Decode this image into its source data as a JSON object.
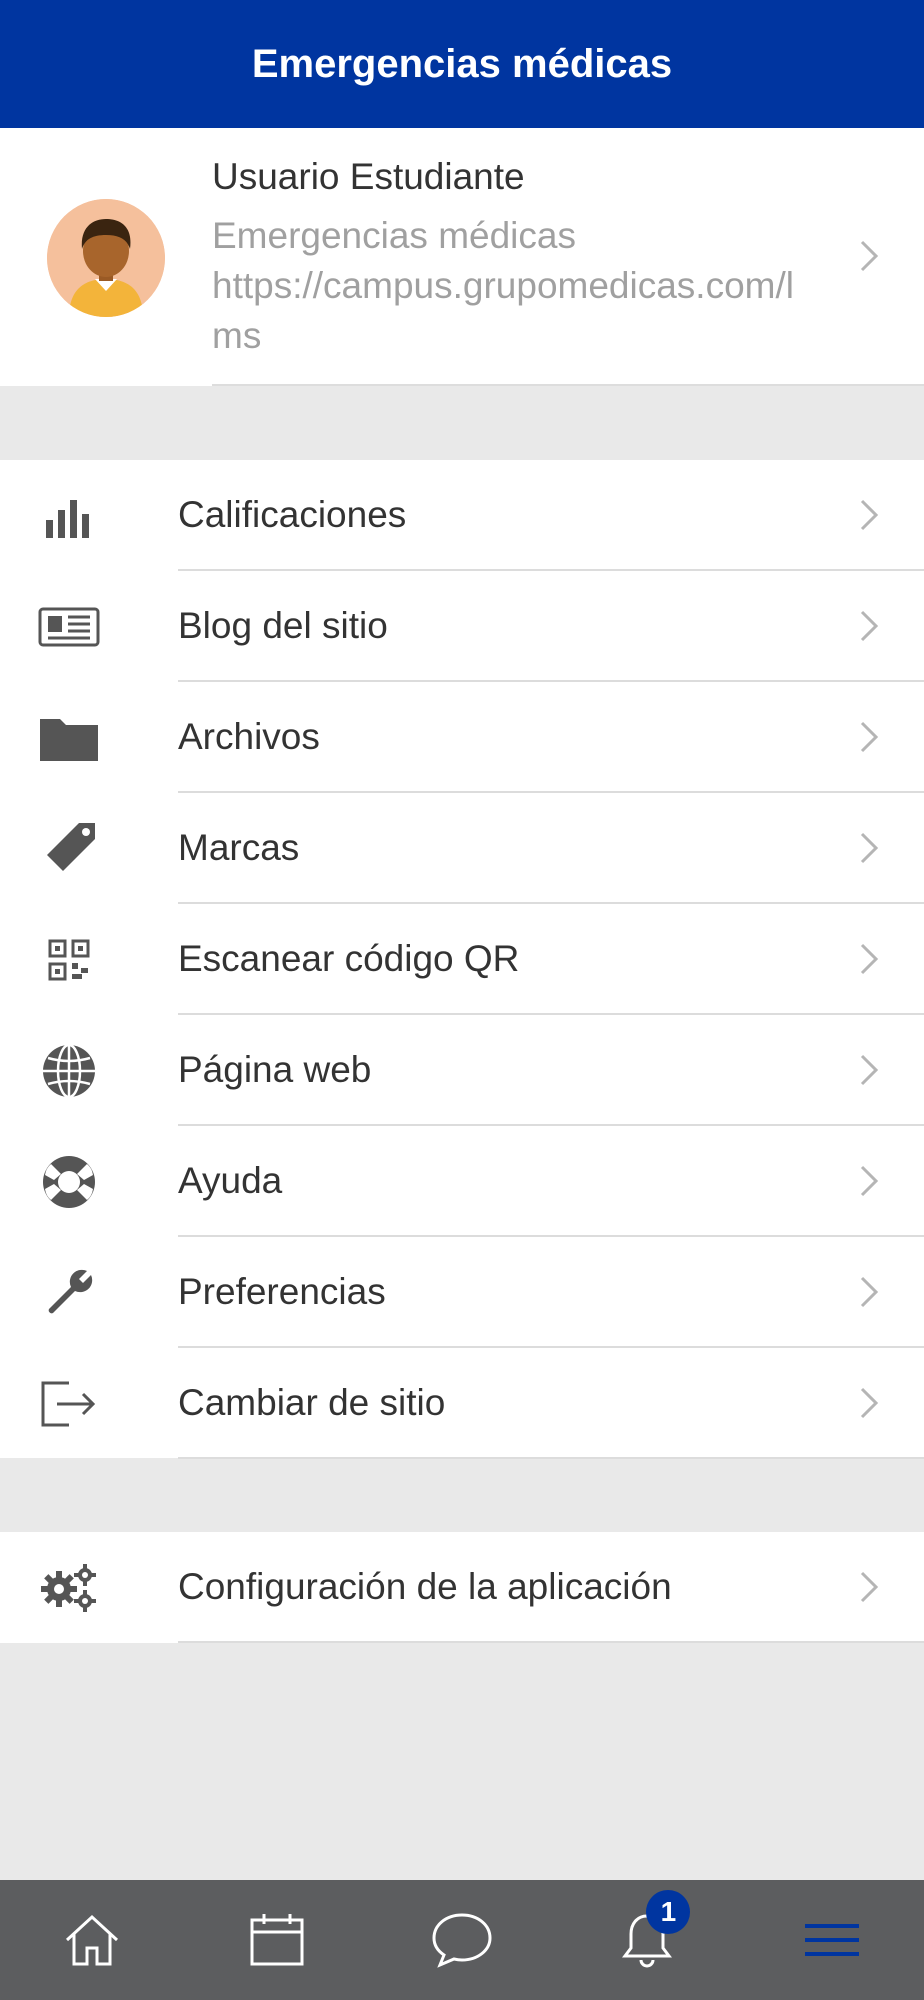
{
  "header": {
    "title": "Emergencias médicas"
  },
  "profile": {
    "name": "Usuario Estudiante",
    "site": "Emergencias médicas",
    "url": "https://campus.grupomedicas.com/lms"
  },
  "menu": {
    "items": [
      {
        "label": "Calificaciones",
        "icon": "bar-chart-icon"
      },
      {
        "label": "Blog del sitio",
        "icon": "newspaper-icon"
      },
      {
        "label": "Archivos",
        "icon": "folder-icon"
      },
      {
        "label": "Marcas",
        "icon": "tag-icon"
      },
      {
        "label": "Escanear código QR",
        "icon": "qr-code-icon"
      },
      {
        "label": "Página web",
        "icon": "globe-icon"
      },
      {
        "label": "Ayuda",
        "icon": "life-ring-icon"
      },
      {
        "label": "Preferencias",
        "icon": "wrench-icon"
      },
      {
        "label": "Cambiar de sitio",
        "icon": "sign-out-icon"
      }
    ]
  },
  "settings": {
    "label": "Configuración de la aplicación",
    "icon": "gears-icon"
  },
  "tabbar": {
    "tabs": [
      {
        "name": "home",
        "icon": "home-icon"
      },
      {
        "name": "calendar",
        "icon": "calendar-icon"
      },
      {
        "name": "messages",
        "icon": "chat-icon"
      },
      {
        "name": "notifications",
        "icon": "bell-icon"
      },
      {
        "name": "more",
        "icon": "menu-icon"
      }
    ],
    "notification_count": "1"
  },
  "colors": {
    "header_bg": "#0035a0",
    "tabbar_bg": "#5c5d5f",
    "badge_bg": "#0035a0",
    "active_tab": "#0035a0",
    "icon_gray": "#555555"
  }
}
